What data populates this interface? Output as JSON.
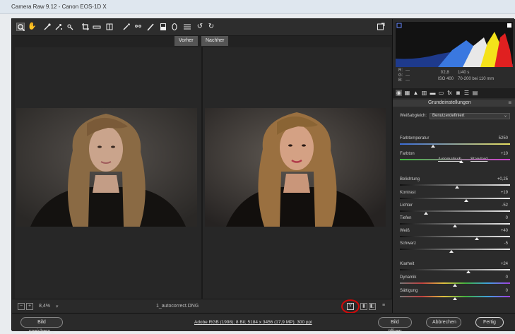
{
  "window": {
    "title": "Camera Raw 9.12 - Canon EOS-1D X"
  },
  "toolbar": {
    "tools": [
      "zoom-tool",
      "hand-tool",
      "white-balance-tool",
      "color-sampler-tool",
      "targeted-adjustment-tool",
      "crop-tool",
      "straighten-tool",
      "transform-tool",
      "spot-removal-tool",
      "red-eye-tool",
      "adjustment-brush-tool",
      "graduated-filter-tool",
      "radial-filter-tool",
      "preferences-tool",
      "rotate-ccw-tool",
      "rotate-cw-tool",
      "toggle-fullscreen"
    ]
  },
  "view": {
    "before_label": "Vorher",
    "after_label": "Nachher"
  },
  "status": {
    "zoom": "8,4%",
    "filename": "1_autocorrect.DNG"
  },
  "histogram": {
    "r": "R:",
    "g": "G:",
    "b": "B:",
    "dash": "---",
    "aperture": "f/2,8",
    "shutter": "1/40 s",
    "iso": "ISO 400",
    "lens": "70-200 bei 110 mm"
  },
  "panel": {
    "title": "Grundeinstellungen",
    "wb_label": "Weißabgleich:",
    "wb_value": "Benutzerdefiniert",
    "auto_label": "Automatisch",
    "default_label": "Standard",
    "sliders": [
      {
        "label": "Farbtemperatur",
        "value": "5250",
        "pos": 0.3
      },
      {
        "label": "Farbton",
        "value": "+10",
        "pos": 0.56
      },
      {
        "label": "Belichtung",
        "value": "+0,25",
        "pos": 0.52
      },
      {
        "label": "Kontrast",
        "value": "+19",
        "pos": 0.6
      },
      {
        "label": "Lichter",
        "value": "-52",
        "pos": 0.24
      },
      {
        "label": "Tiefen",
        "value": "0",
        "pos": 0.5
      },
      {
        "label": "Weiß",
        "value": "+40",
        "pos": 0.7
      },
      {
        "label": "Schwarz",
        "value": "-5",
        "pos": 0.47
      },
      {
        "label": "Klarheit",
        "value": "+24",
        "pos": 0.62
      },
      {
        "label": "Dynamik",
        "value": "0",
        "pos": 0.5
      },
      {
        "label": "Sättigung",
        "value": "0",
        "pos": 0.5
      }
    ]
  },
  "bottom": {
    "save_label": "Bild speichern...",
    "info": "Adobe RGB (1998); 8 Bit; 5184 x 3456 (17,9 MP); 300 ppi",
    "open_label": "Bild öffnen",
    "cancel_label": "Abbrechen",
    "done_label": "Fertig"
  },
  "colors": {
    "accent_circle": "#d10a0a",
    "panel_bg": "#2b2b2b",
    "preview_bg": "#262626"
  }
}
